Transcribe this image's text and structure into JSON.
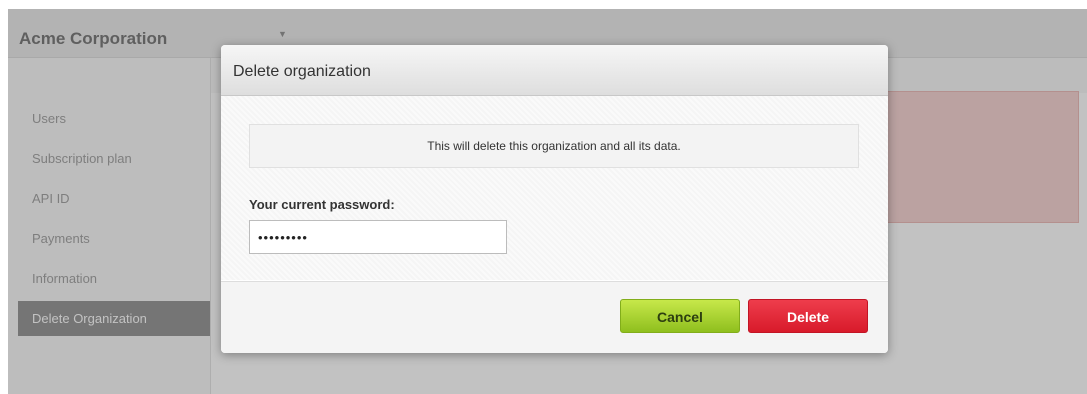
{
  "page": {
    "organization_name": "Acme Corporation",
    "caret": "▼",
    "sidebar": {
      "items": [
        {
          "label": "Users"
        },
        {
          "label": "Subscription plan"
        },
        {
          "label": "API ID"
        },
        {
          "label": "Payments"
        },
        {
          "label": "Information"
        },
        {
          "label": "Delete Organization",
          "active": true
        }
      ]
    }
  },
  "modal": {
    "title": "Delete organization",
    "notice": "This will delete this organization and all its data.",
    "password_label": "Your current password:",
    "password_value": "•••••••••",
    "cancel_label": "Cancel",
    "delete_label": "Delete"
  },
  "colors": {
    "cancel_button": "#9acd32",
    "delete_button": "#e3222f",
    "active_sidebar": "#7a7a7a"
  }
}
